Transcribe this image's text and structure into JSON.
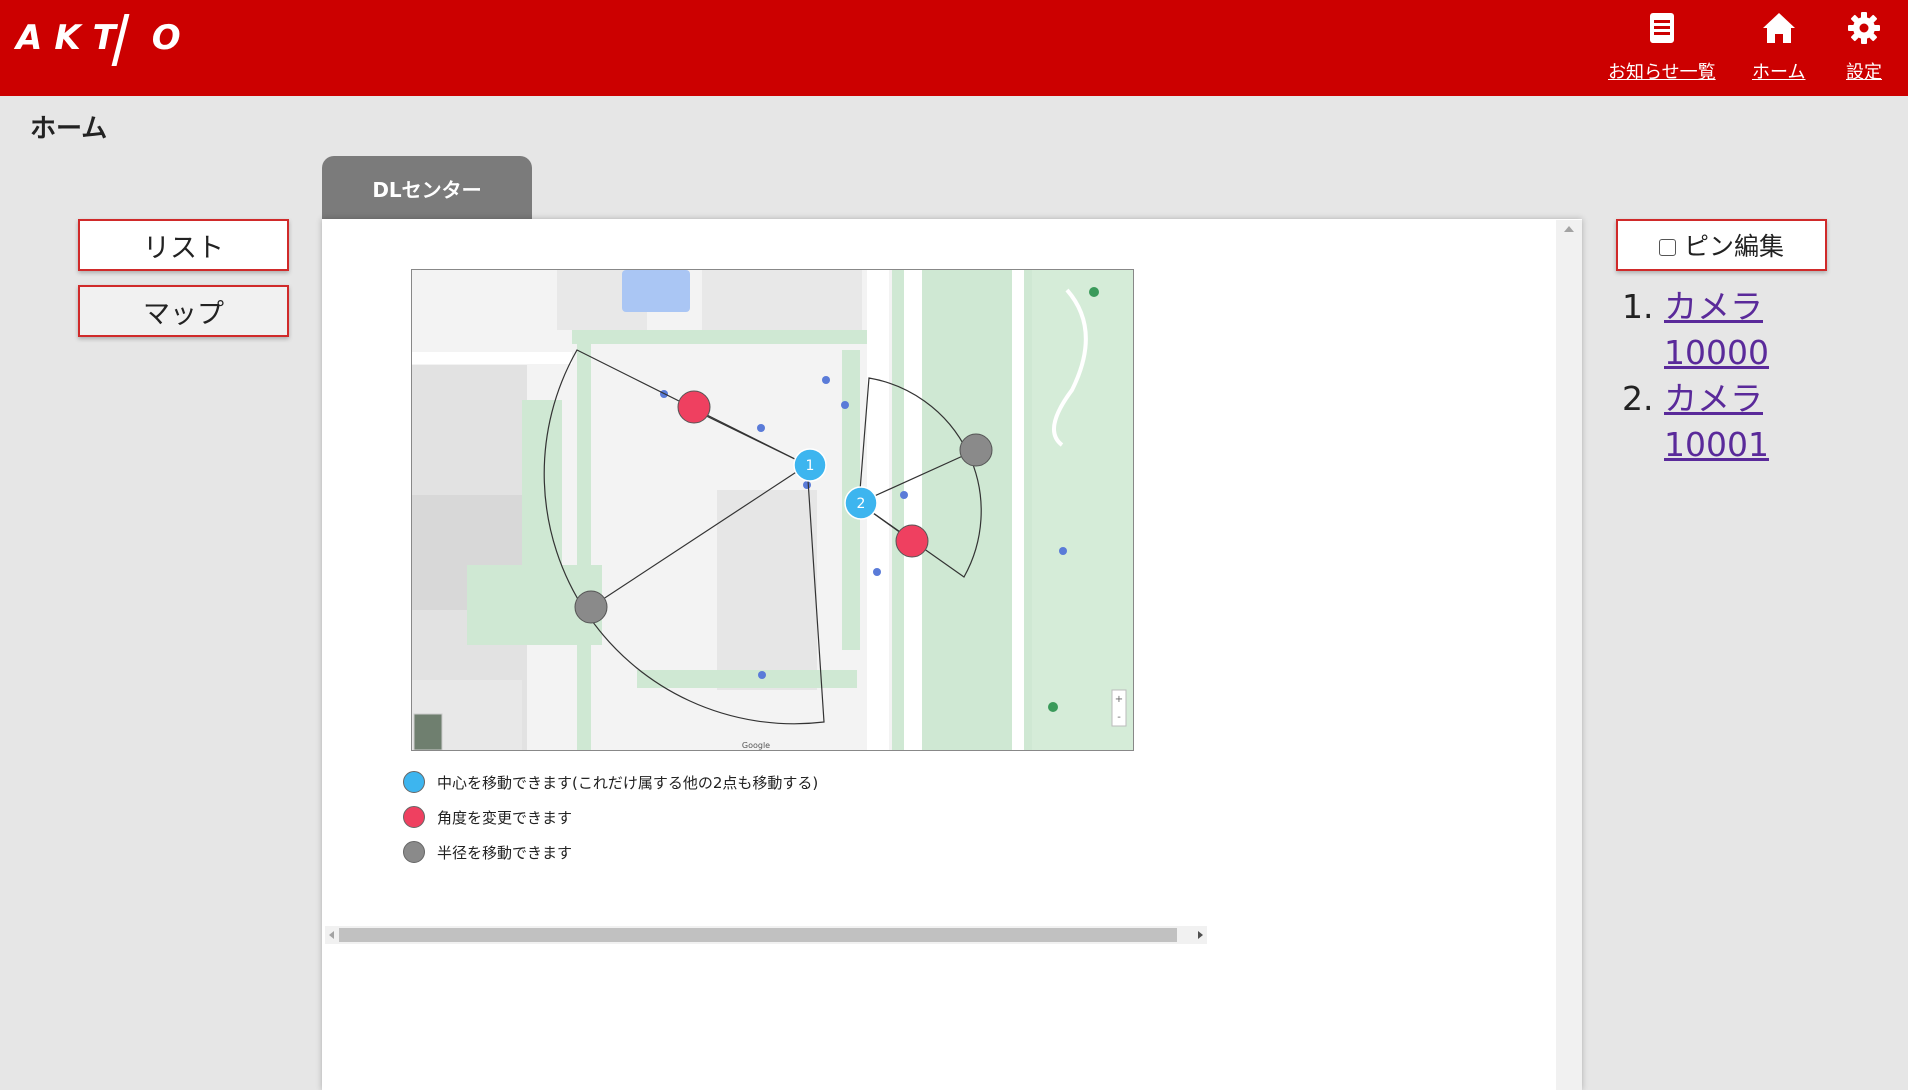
{
  "header": {
    "logo_text": "AKT O",
    "nav": [
      {
        "label": "お知らせ一覧",
        "icon": "document-list-icon"
      },
      {
        "label": "ホーム",
        "icon": "home-icon"
      },
      {
        "label": "設定",
        "icon": "gear-icon"
      }
    ]
  },
  "page": {
    "title": "ホーム"
  },
  "sidebar": {
    "list_label": "リスト",
    "map_label": "マップ"
  },
  "tabs": [
    {
      "label": "DLセンター",
      "active": true
    }
  ],
  "map": {
    "provider_text": "Google",
    "pins": [
      {
        "number": "1",
        "type": "center"
      },
      {
        "number": "2",
        "type": "center"
      }
    ]
  },
  "legend": [
    {
      "color": "#3db5ef",
      "text": "中心を移動できます(これだけ属する他の2点も移動する)"
    },
    {
      "color": "#ef4060",
      "text": "角度を変更できます"
    },
    {
      "color": "#8a8a8a",
      "text": "半径を移動できます"
    }
  ],
  "pin_edit": {
    "label": "ピン編集",
    "checked": false
  },
  "cameras": [
    {
      "number": "1.",
      "name_line1": "カメラ",
      "name_line2": "10000"
    },
    {
      "number": "2.",
      "name_line1": "カメラ",
      "name_line2": "10001"
    }
  ],
  "colors": {
    "brand_red": "#cc0000",
    "tab_gray": "#7b7b7b",
    "link_purple": "#5a2a9a"
  }
}
